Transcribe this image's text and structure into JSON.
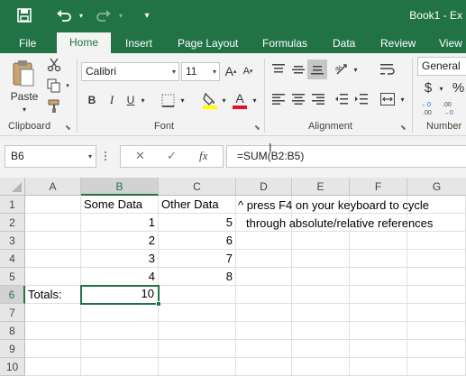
{
  "title_bar": {
    "document_title": "Book1 - Ex",
    "icons": {
      "save": "save-icon",
      "undo": "undo-icon",
      "redo": "redo-icon"
    },
    "background_color": "#217346"
  },
  "tabs": [
    {
      "label": "File",
      "active": false
    },
    {
      "label": "Home",
      "active": true
    },
    {
      "label": "Insert",
      "active": false
    },
    {
      "label": "Page Layout",
      "active": false
    },
    {
      "label": "Formulas",
      "active": false
    },
    {
      "label": "Data",
      "active": false
    },
    {
      "label": "Review",
      "active": false
    },
    {
      "label": "View",
      "active": false
    }
  ],
  "ribbon": {
    "clipboard": {
      "label": "Clipboard",
      "paste_label": "Paste",
      "icons": [
        "paste-icon",
        "cut-icon",
        "copy-icon",
        "format-painter-icon"
      ]
    },
    "font": {
      "label": "Font",
      "font_name": "Calibri",
      "font_size": "11",
      "grow_font": "A",
      "shrink_font": "A",
      "bold": "B",
      "italic": "I",
      "underline": "U",
      "font_color_letter": "A",
      "font_color_swatch": "#e81123",
      "fill_color_swatch": "#ffff00"
    },
    "alignment": {
      "label": "Alignment"
    },
    "number": {
      "label": "Number",
      "format": "General",
      "currency_symbol": "$",
      "percent_symbol": "%"
    }
  },
  "formula_bar": {
    "name_box": "B6",
    "fx_label": "fx",
    "formula": "=SUM(B2:B5)"
  },
  "sheet": {
    "columns": [
      "A",
      "B",
      "C",
      "D",
      "E",
      "F",
      "G"
    ],
    "rows": [
      "1",
      "2",
      "3",
      "4",
      "5",
      "6",
      "7",
      "8",
      "9",
      "10"
    ],
    "selected_column": "B",
    "selected_row": "6",
    "cells": {
      "B1": "Some Data",
      "C1": "Other Data",
      "B2": "1",
      "C2": "5",
      "B3": "2",
      "C3": "6",
      "B4": "3",
      "C4": "7",
      "B5": "4",
      "C5": "8",
      "A6": "Totals:",
      "B6": "10"
    },
    "note_line1": "^ press F4 on your keyboard to cycle",
    "note_line2": "through absolute/relative references"
  },
  "colors": {
    "accent": "#217346",
    "ribbon_bg": "#f3f3f3",
    "header_bg": "#e6e6e6"
  }
}
